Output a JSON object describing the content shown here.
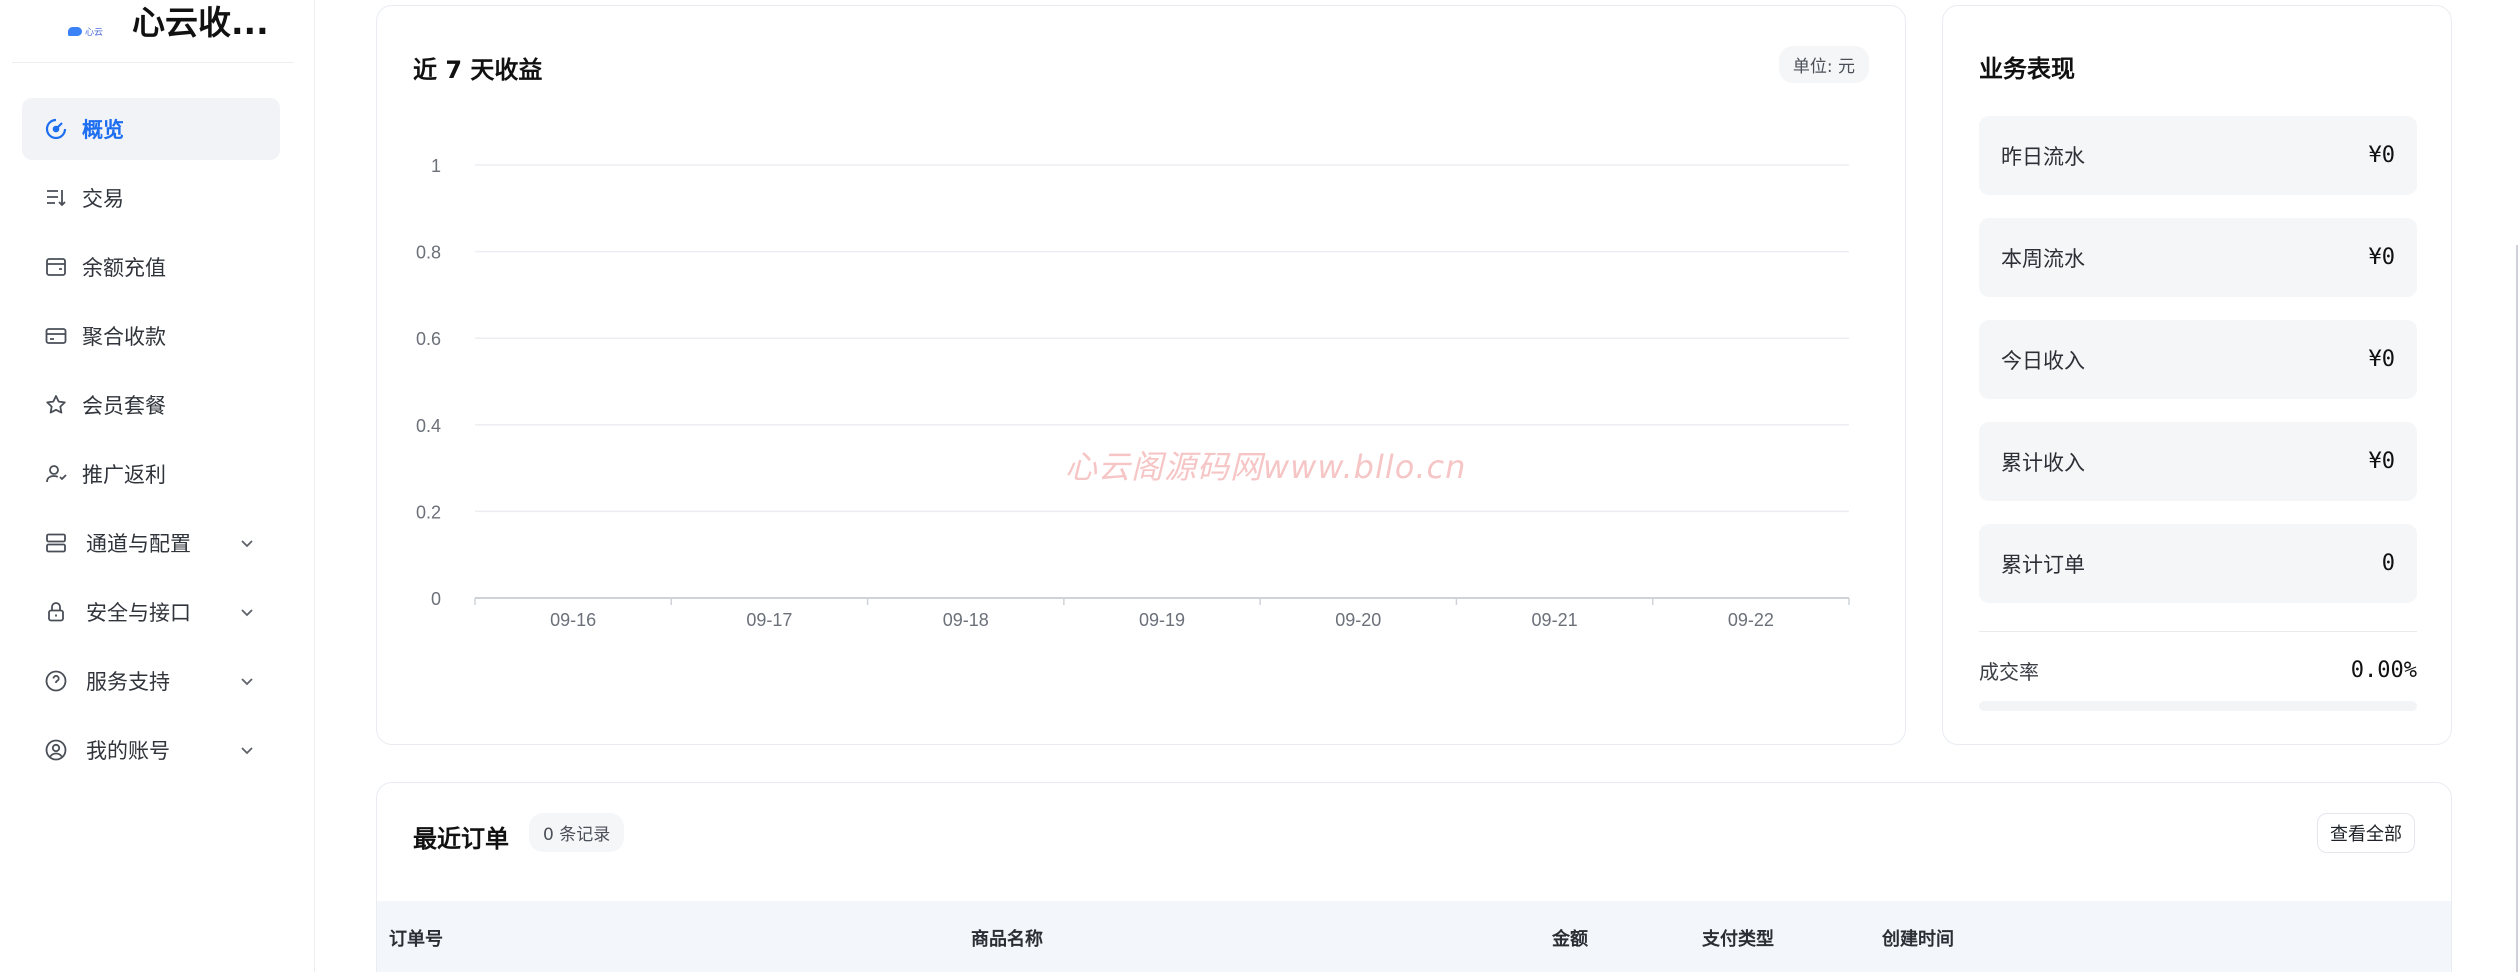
{
  "brand": {
    "logo_text": "心云",
    "name": "心云收..."
  },
  "sidebar": {
    "items": [
      {
        "label": "概览",
        "icon": "gauge-icon",
        "active": true,
        "expandable": false
      },
      {
        "label": "交易",
        "icon": "list-sort-icon",
        "active": false,
        "expandable": false
      },
      {
        "label": "余额充值",
        "icon": "wallet-icon",
        "active": false,
        "expandable": false
      },
      {
        "label": "聚合收款",
        "icon": "card-icon",
        "active": false,
        "expandable": false
      },
      {
        "label": "会员套餐",
        "icon": "star-icon",
        "active": false,
        "expandable": false
      },
      {
        "label": "推广返利",
        "icon": "users-icon",
        "active": false,
        "expandable": false
      },
      {
        "label": "通道与配置",
        "icon": "server-icon",
        "active": false,
        "expandable": true
      },
      {
        "label": "安全与接口",
        "icon": "lock-icon",
        "active": false,
        "expandable": true
      },
      {
        "label": "服务支持",
        "icon": "help-icon",
        "active": false,
        "expandable": true
      },
      {
        "label": "我的账号",
        "icon": "user-circle-icon",
        "active": false,
        "expandable": true
      }
    ]
  },
  "revenue": {
    "title": "近 7 天收益",
    "unit_label": "单位: 元",
    "watermark": "心云阁源码网www.bllo.cn"
  },
  "chart_data": {
    "type": "line",
    "title": "近 7 天收益",
    "xlabel": "",
    "ylabel": "",
    "categories": [
      "09-16",
      "09-17",
      "09-18",
      "09-19",
      "09-20",
      "09-21",
      "09-22"
    ],
    "series": [
      {
        "values": [
          0,
          0,
          0,
          0,
          0,
          0,
          0
        ]
      }
    ],
    "ylim": [
      0,
      1
    ],
    "yticks": [
      "0",
      "0.2",
      "0.4",
      "0.6",
      "0.8",
      "1"
    ],
    "grid": true,
    "colors": {
      "grid": "#eceef2",
      "axis": "#cfd3d9",
      "tick_text": "#6b7079"
    }
  },
  "business": {
    "title": "业务表现",
    "metrics": [
      {
        "label": "昨日流水",
        "value": "¥0"
      },
      {
        "label": "本周流水",
        "value": "¥0"
      },
      {
        "label": "今日收入",
        "value": "¥0"
      },
      {
        "label": "累计收入",
        "value": "¥0"
      },
      {
        "label": "累计订单",
        "value": "0"
      }
    ],
    "rate_label": "成交率",
    "rate_value": "0.00%",
    "rate_fraction": 0
  },
  "orders": {
    "title": "最近订单",
    "count_label": "0 条记录",
    "view_all_label": "查看全部",
    "columns": [
      "订单号",
      "商品名称",
      "金额",
      "支付类型",
      "创建时间"
    ]
  },
  "colors": {
    "accent": "#1d6ef0",
    "active_bg": "#f1f3f6",
    "card_border": "#e9ecf1"
  }
}
